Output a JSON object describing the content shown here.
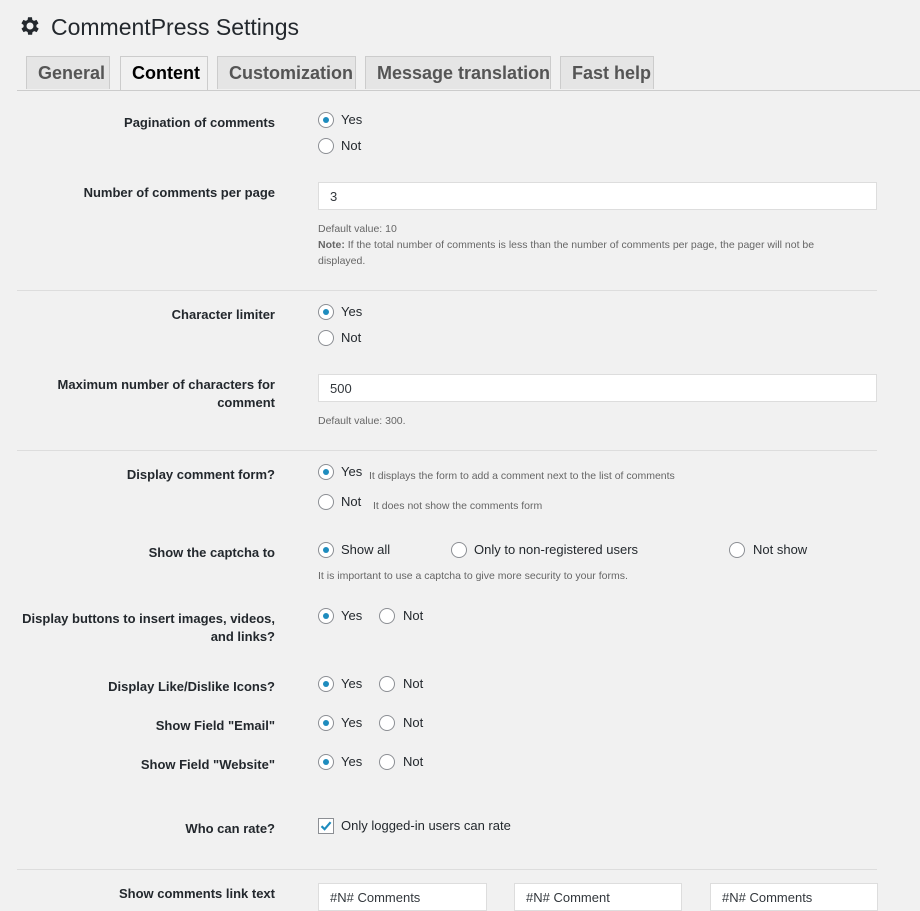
{
  "page": {
    "title": "CommentPress Settings",
    "icon": "gear-icon"
  },
  "tabs": [
    {
      "label": "General",
      "active": false
    },
    {
      "label": "Content",
      "active": true
    },
    {
      "label": "Customization",
      "active": false
    },
    {
      "label": "Message translation",
      "active": false
    },
    {
      "label": "Fast help",
      "active": false
    }
  ],
  "pagination": {
    "label": "Pagination of comments",
    "yes": "Yes",
    "no": "Not",
    "selected": "Yes"
  },
  "per_page": {
    "label": "Number of comments per page",
    "value": "3",
    "default": "Default value: 10",
    "note_label": "Note:",
    "note": " If the total number of comments is less than the number of comments per page, the pager will not be displayed."
  },
  "char_limiter": {
    "label": "Character limiter",
    "yes": "Yes",
    "no": "Not",
    "selected": "Yes"
  },
  "max_chars": {
    "label_line1": "Maximum number of characters for",
    "label_line2": "comment",
    "value": "500",
    "default": "Default value: 300."
  },
  "comment_form": {
    "label": "Display comment form?",
    "yes": "Yes",
    "yes_hint": "It displays the form to add a comment next to the list of comments",
    "no": "Not",
    "no_hint": "It does not show the comments form",
    "selected": "Yes"
  },
  "captcha": {
    "label": "Show the captcha to",
    "options": [
      "Show all",
      "Only to non-registered users",
      "Not show"
    ],
    "selected": "Show all",
    "hint": "It is important to use a captcha to give more security to your forms."
  },
  "media_buttons": {
    "label_line1": "Display buttons to insert images, videos,",
    "label_line2": "and links?",
    "yes": "Yes",
    "no": "Not",
    "selected": "Yes"
  },
  "like_dislike": {
    "label": "Display Like/Dislike Icons?",
    "yes": "Yes",
    "no": "Not",
    "selected": "Yes"
  },
  "field_email": {
    "label": "Show Field \"Email\"",
    "yes": "Yes",
    "no": "Not",
    "selected": "Yes"
  },
  "field_website": {
    "label": "Show Field \"Website\"",
    "yes": "Yes",
    "no": "Not",
    "selected": "Yes"
  },
  "rating": {
    "label": "Who can rate?",
    "checkbox_label": "Only logged-in users can rate",
    "checked": true
  },
  "link_text": {
    "label": "Show comments link text",
    "values": [
      "#N# Comments",
      "#N# Comment",
      "#N# Comments"
    ]
  },
  "colors": {
    "radio_selected": "#1e8cbe",
    "checkbox_check": "#1e8cbe"
  }
}
